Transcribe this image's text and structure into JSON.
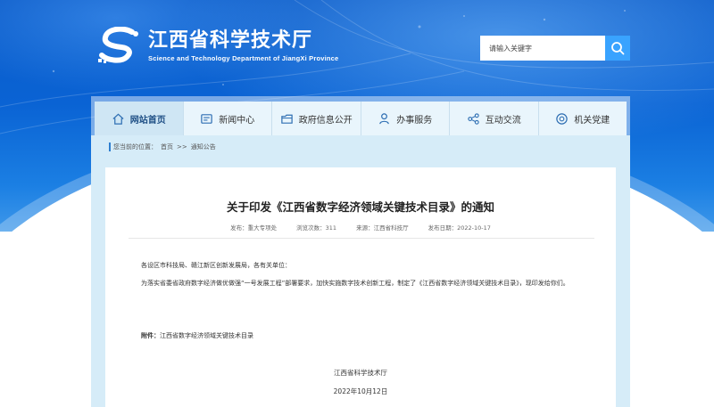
{
  "header": {
    "site_title": "江西省科学技术厅",
    "site_subtitle": "Science and Technology Department of JiangXi Province",
    "logo_icon": "provincial-s-logo-icon"
  },
  "search": {
    "placeholder": "请输入关键字",
    "icon": "search-icon"
  },
  "nav": {
    "items": [
      {
        "label": "网站首页",
        "icon": "home-icon",
        "active": true
      },
      {
        "label": "新闻中心",
        "icon": "news-icon",
        "active": false
      },
      {
        "label": "政府信息公开",
        "icon": "folder-icon",
        "active": false
      },
      {
        "label": "办事服务",
        "icon": "person-icon",
        "active": false
      },
      {
        "label": "互动交流",
        "icon": "share-icon",
        "active": false
      },
      {
        "label": "机关党建",
        "icon": "badge-icon",
        "active": false
      }
    ]
  },
  "breadcrumb": {
    "prefix": "您当前的位置：",
    "home": "首页",
    "separator": ">>",
    "current": "通知公告"
  },
  "article": {
    "title": "关于印发《江西省数字经济领域关键技术目录》的通知",
    "meta": {
      "publisher": "发布：重大专项处",
      "views": "浏览次数：311",
      "source": "来源：江西省科技厅",
      "date": "发布日期：2022-10-17"
    },
    "salutation": "各设区市科技局、赣江新区创新发展局，各有关单位：",
    "body": "为落实省委省政府数字经济做优做强“一号发展工程”部署要求，加快实施数字技术创新工程，制定了《江西省数字经济领域关键技术目录》，现印发给你们。",
    "attachment_label": "附件：",
    "attachment_name": "江西省数字经济领域关键技术目录",
    "signature_org": "江西省科学技术厅",
    "signature_date": "2022年10月12日"
  },
  "colors": {
    "header_blue": "#0a63d4",
    "search_button": "#39a3ff",
    "nav_bg": "#e9f5fc",
    "nav_active": "#cfe6f4",
    "frame": "#d6ecf8"
  }
}
